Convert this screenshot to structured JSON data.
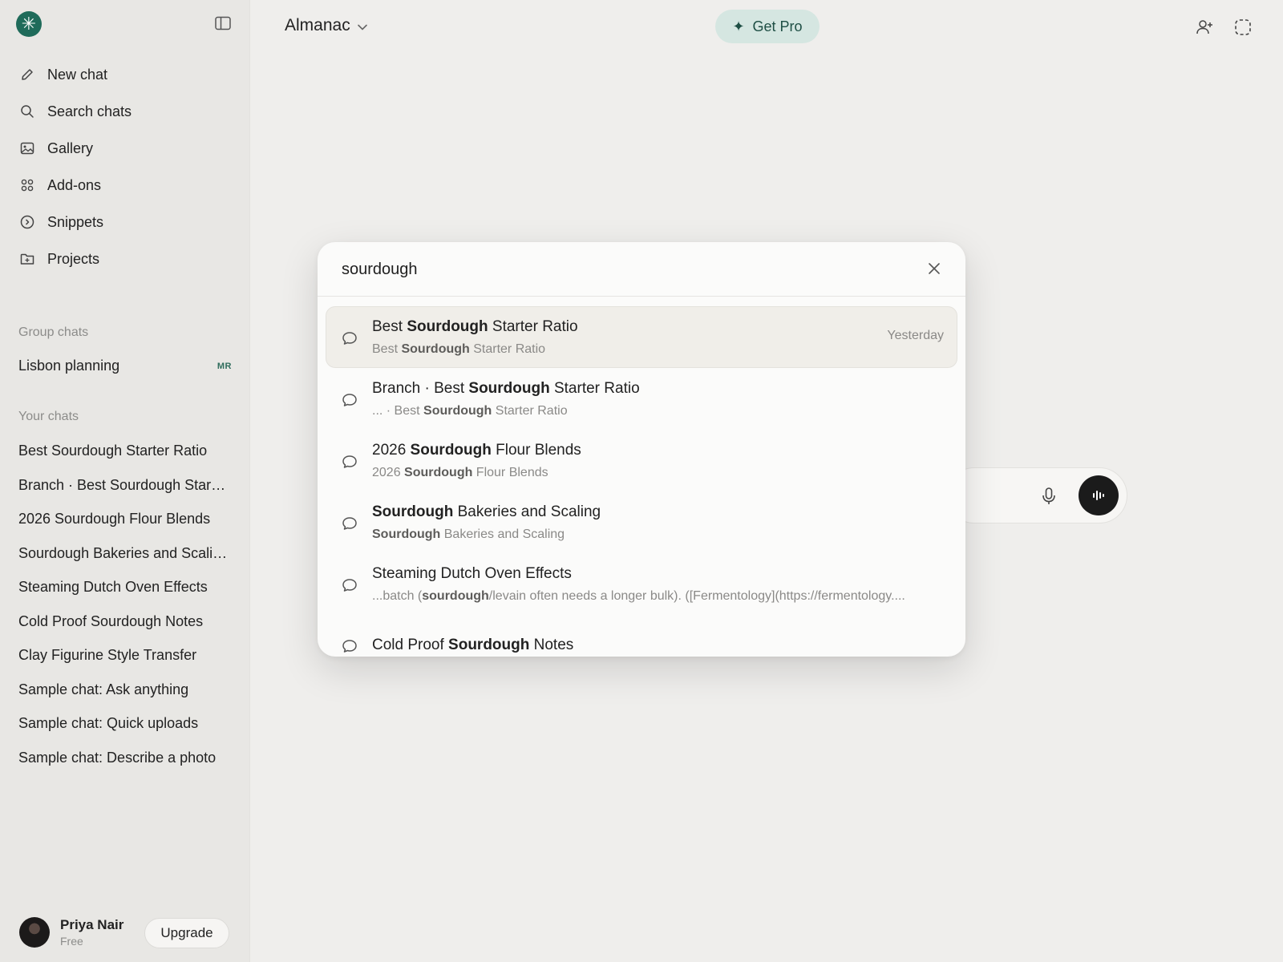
{
  "sidebar": {
    "nav": [
      {
        "label": "New chat",
        "icon": "pencil-icon"
      },
      {
        "label": "Search chats",
        "icon": "search-icon"
      },
      {
        "label": "Gallery",
        "icon": "image-icon"
      },
      {
        "label": "Add-ons",
        "icon": "grid-icon"
      },
      {
        "label": "Snippets",
        "icon": "play-circle-icon"
      },
      {
        "label": "Projects",
        "icon": "folder-icon"
      }
    ],
    "group_label": "Group chats",
    "group_chat": {
      "name": "Lisbon planning",
      "badge": "MR"
    },
    "chats_label": "Your chats",
    "chats": [
      "Best Sourdough Starter Ratio",
      "Branch · Best Sourdough Starter Ratio",
      "2026 Sourdough Flour Blends",
      "Sourdough Bakeries and Scaling",
      "Steaming Dutch Oven Effects",
      "Cold Proof Sourdough Notes",
      "Clay Figurine Style Transfer",
      "Sample chat: Ask anything",
      "Sample chat: Quick uploads",
      "Sample chat: Describe a photo"
    ],
    "user": {
      "name": "Priya Nair",
      "plan": "Free"
    },
    "upgrade_label": "Upgrade"
  },
  "header": {
    "model": "Almanac",
    "get_pro": "Get Pro"
  },
  "search": {
    "query": "sourdough",
    "results": [
      {
        "title_pre": "Best ",
        "title_hl": "Sourdough",
        "title_post": " Starter Ratio",
        "snip_pre": "Best ",
        "snip_hl": "Sourdough",
        "snip_post": " Starter Ratio",
        "date": "Yesterday"
      },
      {
        "title_pre": "Branch · Best ",
        "title_hl": "Sourdough",
        "title_post": " Starter Ratio",
        "snip_pre": "... · Best ",
        "snip_hl": "Sourdough",
        "snip_post": " Starter Ratio",
        "date": ""
      },
      {
        "title_pre": "2026 ",
        "title_hl": "Sourdough",
        "title_post": " Flour Blends",
        "snip_pre": "2026 ",
        "snip_hl": "Sourdough",
        "snip_post": " Flour Blends",
        "date": ""
      },
      {
        "title_pre": "",
        "title_hl": "Sourdough",
        "title_post": " Bakeries and Scaling",
        "snip_pre": "",
        "snip_hl": "Sourdough",
        "snip_post": " Bakeries and Scaling",
        "date": ""
      },
      {
        "title_pre": "Steaming Dutch Oven Effects",
        "title_hl": "",
        "title_post": "",
        "snip_pre": "...batch (",
        "snip_hl": "sourdough",
        "snip_post": "/levain often needs a longer bulk). ([Fermentology](https://fermentology....",
        "date": ""
      },
      {
        "title_pre": "Cold Proof ",
        "title_hl": "Sourdough",
        "title_post": " Notes",
        "snip_pre": "",
        "snip_hl": "",
        "snip_post": "",
        "date": ""
      }
    ]
  },
  "colors": {
    "accent": "#1f6b5a",
    "pro_bg": "#d5e6e1"
  }
}
